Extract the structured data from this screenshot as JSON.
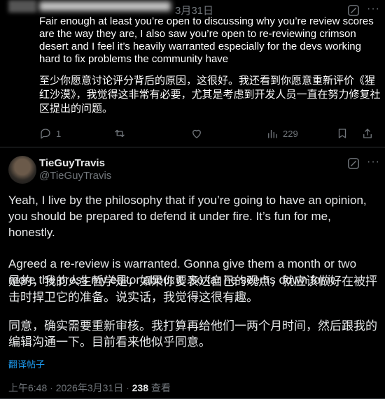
{
  "reply": {
    "date": "3月31日",
    "text_en": "Fair enough at least you’re open to discussing why you’re review scores are the way they are, I also saw you’re open to re-reviewing crimson desert and I feel it’s heavily warranted especially for the devs working hard to fix problems the community have",
    "text_zh": "至少你愿意讨论评分背后的原因，这很好。我还看到你愿意重新评价《猩红沙漠》，我觉得这非常有必要，尤其是考虑到开发人员一直在努力修复社区提出的问题。",
    "actions": {
      "replies": "1",
      "retweets": "",
      "likes": "",
      "views": "229"
    }
  },
  "post": {
    "display_name": "TieGuyTravis",
    "handle": "@TieGuyTravis",
    "paragraph_en_1": "Yeah, I live by the philosophy that if you’re going to have an opinion, you should be prepared to defend it under fire. It’s fun for me, honestly.",
    "paragraph_en_2": "Agreed a re-review is warranted. Gonna give them a month or two more the press my editor about it. So far he seems down for it.",
    "paragraph_zh_1": "是的，我的人生哲学是，如果你要表达自己的观点，就应该做好在被抨击时捍卫它的准备。说实话，我觉得这很有趣。",
    "paragraph_zh_2": "同意，确实需要重新审核。我打算再给他们一两个月时间，然后跟我的编辑沟通一下。目前看来他似乎同意。",
    "translate_label": "翻译帖子",
    "timestamp": "上午6:48 · 2026年3月31日 · ",
    "view_count": "238",
    "view_label": " 查看"
  },
  "icons": {
    "reply": "reply-icon",
    "retweet": "retweet-icon",
    "like": "heart-icon",
    "views": "views-icon",
    "grok": "grok-icon",
    "more": "more-icon"
  },
  "colors": {
    "background": "#000000",
    "text": "#e7e9ea",
    "muted": "#71767b",
    "link": "#1d9bf0",
    "divider": "#2f3336"
  }
}
